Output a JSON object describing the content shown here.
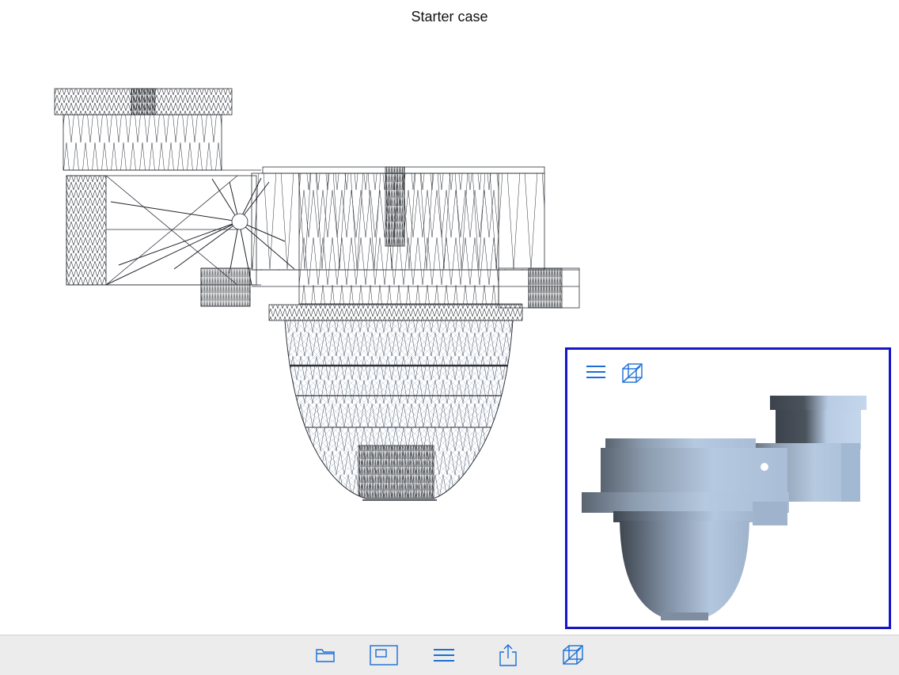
{
  "header": {
    "title": "Starter case"
  },
  "colors": {
    "accent": "#1a6fd6",
    "inset_border": "#1616c8",
    "toolbar_bg": "#ececec",
    "wireframe": "#2b2f36",
    "shaded_light": "#b8cce4",
    "shaded_dark": "#3e4650"
  },
  "viewer": {
    "render_mode": "wireframe",
    "inset_render_mode": "shaded"
  },
  "inset_controls": [
    {
      "icon": "menu-icon"
    },
    {
      "icon": "wireframe-cube-icon"
    }
  ],
  "toolbar": {
    "items": [
      {
        "icon": "folder-icon"
      },
      {
        "icon": "window-view-icon"
      },
      {
        "icon": "menu-icon"
      },
      {
        "icon": "share-icon"
      },
      {
        "icon": "wireframe-cube-icon"
      }
    ]
  }
}
